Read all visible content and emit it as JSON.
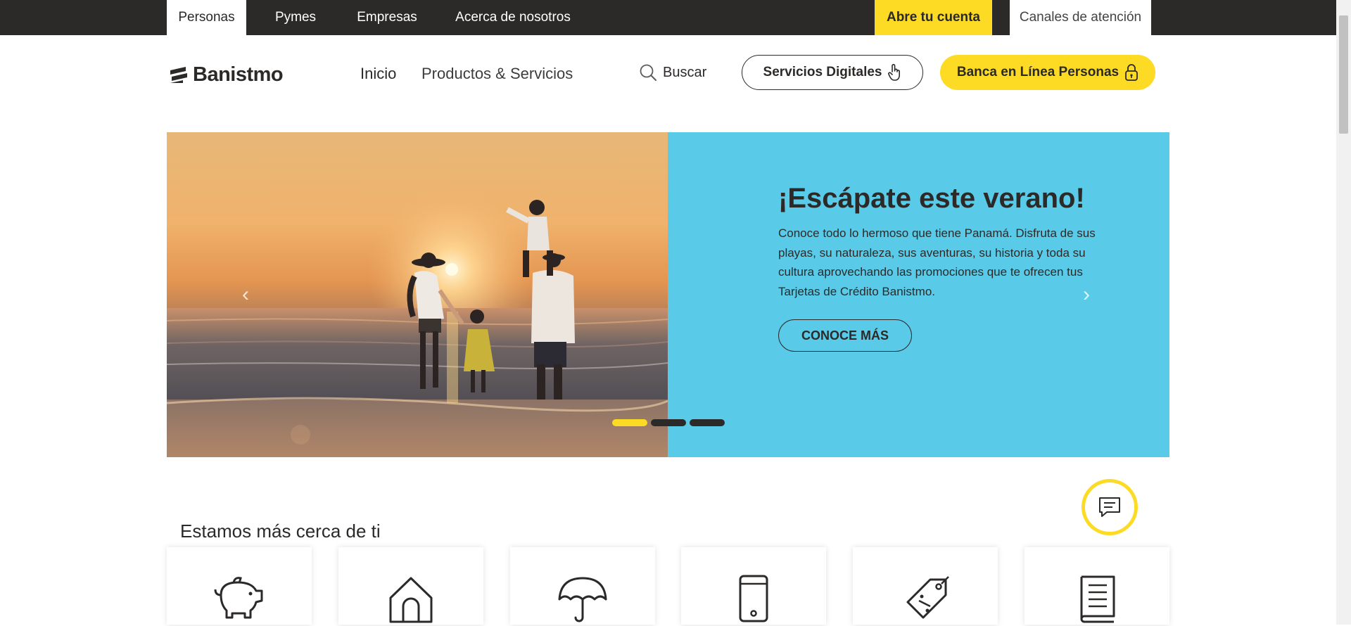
{
  "topbar": {
    "tabs": [
      {
        "label": "Personas"
      },
      {
        "label": "Pymes"
      },
      {
        "label": "Empresas"
      },
      {
        "label": "Acerca de nosotros"
      }
    ],
    "open_account": "Abre tu cuenta",
    "channels": "Canales de atención"
  },
  "header": {
    "logo_text": "Banistmo",
    "nav": [
      {
        "label": "Inicio"
      },
      {
        "label": "Productos & Servicios"
      }
    ],
    "search_label": "Buscar",
    "digital_services": "Servicios Digitales",
    "online_banking": "Banca en Línea Personas"
  },
  "hero": {
    "title": "¡Escápate este verano!",
    "body": "Conoce todo lo hermoso que tiene Panamá. Disfruta de sus playas, su naturaleza, sus aventuras, su historia y toda su cultura aprovechando las promociones que te ofrecen tus Tarjetas de Crédito Banistmo.",
    "cta": "CONOCE MÁS",
    "prev_arrow": "‹",
    "next_arrow": "›",
    "slide_count": 3,
    "active_slide": 1
  },
  "section": {
    "title": "Estamos más cerca de ti",
    "cards": [
      {
        "icon": "piggy-bank-icon"
      },
      {
        "icon": "house-icon"
      },
      {
        "icon": "umbrella-icon"
      },
      {
        "icon": "smartphone-icon"
      },
      {
        "icon": "price-tag-icon"
      },
      {
        "icon": "book-icon"
      }
    ]
  },
  "colors": {
    "brand_yellow": "#fdda24",
    "dark": "#2c2a29",
    "hero_blue": "#59cbe8"
  }
}
